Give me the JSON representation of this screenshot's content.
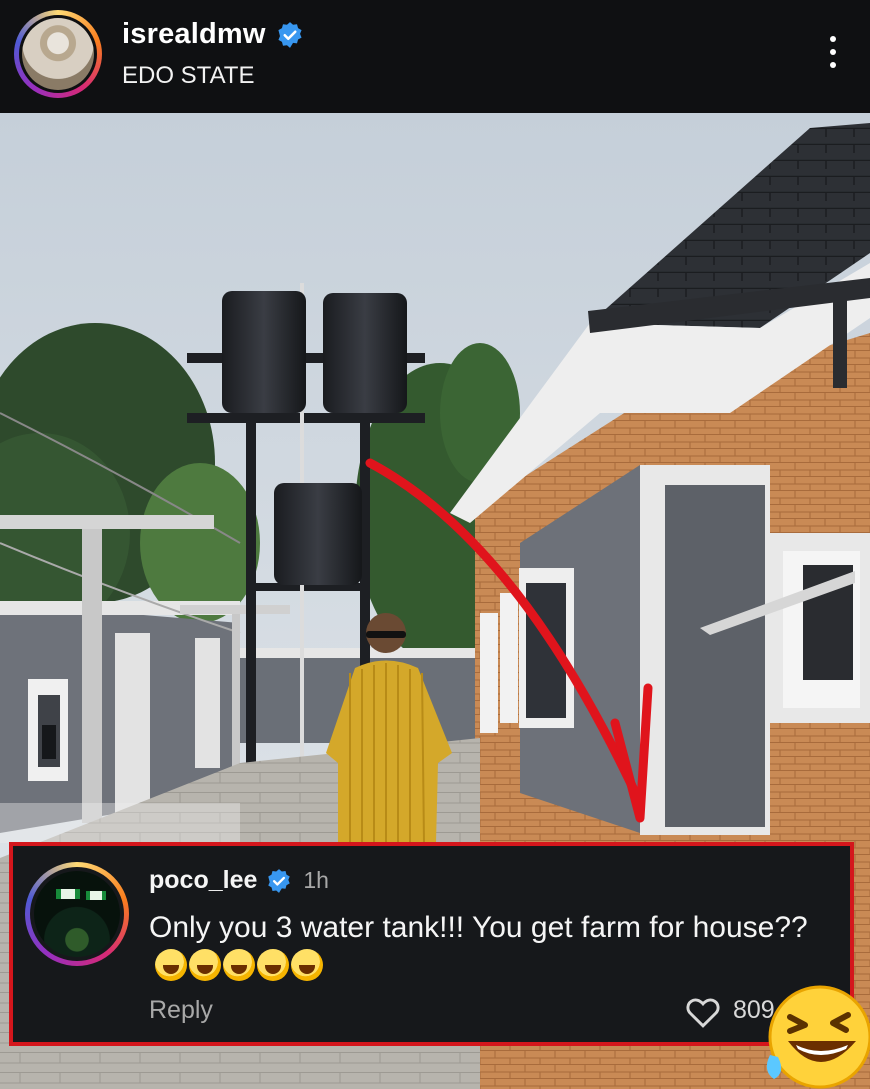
{
  "post": {
    "username": "isrealdmw",
    "location": "EDO STATE"
  },
  "comment": {
    "username": "poco_lee",
    "time": "1h",
    "text": "Only you 3 water tank!!! You get farm for house??",
    "emojis": "🤣🤣🤣🤣😭",
    "reply_label": "Reply",
    "likes": "809"
  },
  "icons": {
    "verified": "verified-badge-icon",
    "more": "more-options-icon",
    "heart": "heart-icon",
    "overlay": "rolling-laughing-emoji"
  },
  "colors": {
    "highlight": "#d4161c",
    "verified": "#3897f0"
  }
}
